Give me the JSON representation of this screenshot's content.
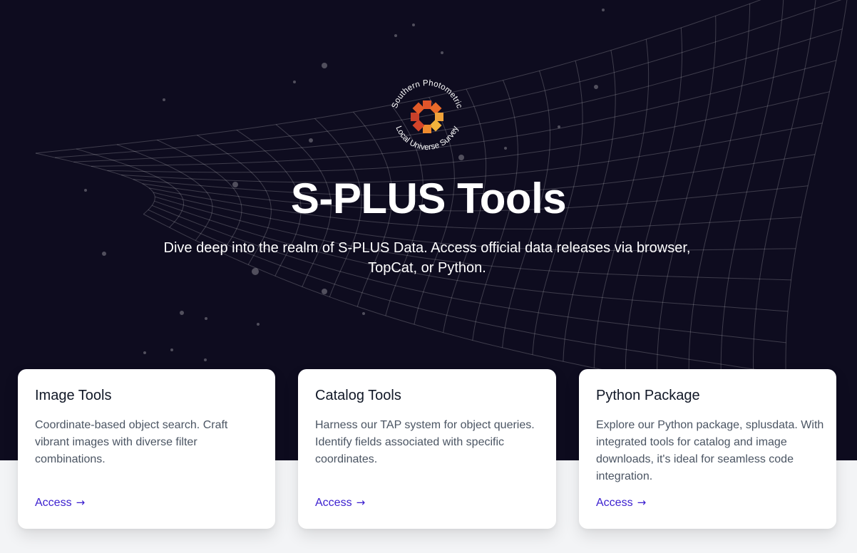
{
  "hero": {
    "logo": {
      "ring_text_top": "Southern Photometric",
      "ring_text_bottom": "Local Universe Survey",
      "colors": [
        "#e0542a",
        "#e96b2a",
        "#f0a23a",
        "#f2b33c",
        "#ef8b2e",
        "#d4452a",
        "#c8402a",
        "#e25a28"
      ]
    },
    "title": "S-PLUS Tools",
    "subtitle": "Dive deep into the realm of S-PLUS Data. Access official data releases via browser, TopCat, or Python.",
    "background": "#0e0c1f"
  },
  "cards": [
    {
      "title": "Image Tools",
      "description": "Coordinate-based object search. Craft vibrant images with diverse filter combinations.",
      "link_label": "Access",
      "link_icon": "arrow-right-icon"
    },
    {
      "title": "Catalog Tools",
      "description": "Harness our TAP system for object queries. Identify fields associated with specific coordinates.",
      "link_label": "Access",
      "link_icon": "arrow-right-icon"
    },
    {
      "title": "Python Package",
      "description": "Explore our Python package, splusdata. With integrated tools for catalog and image downloads, it's ideal for seamless code integration.",
      "link_label": "Access",
      "link_icon": "arrow-right-icon"
    }
  ],
  "colors": {
    "hero_bg": "#0e0c1f",
    "page_bg": "#f3f4f6",
    "link": "#3b1fcf"
  }
}
